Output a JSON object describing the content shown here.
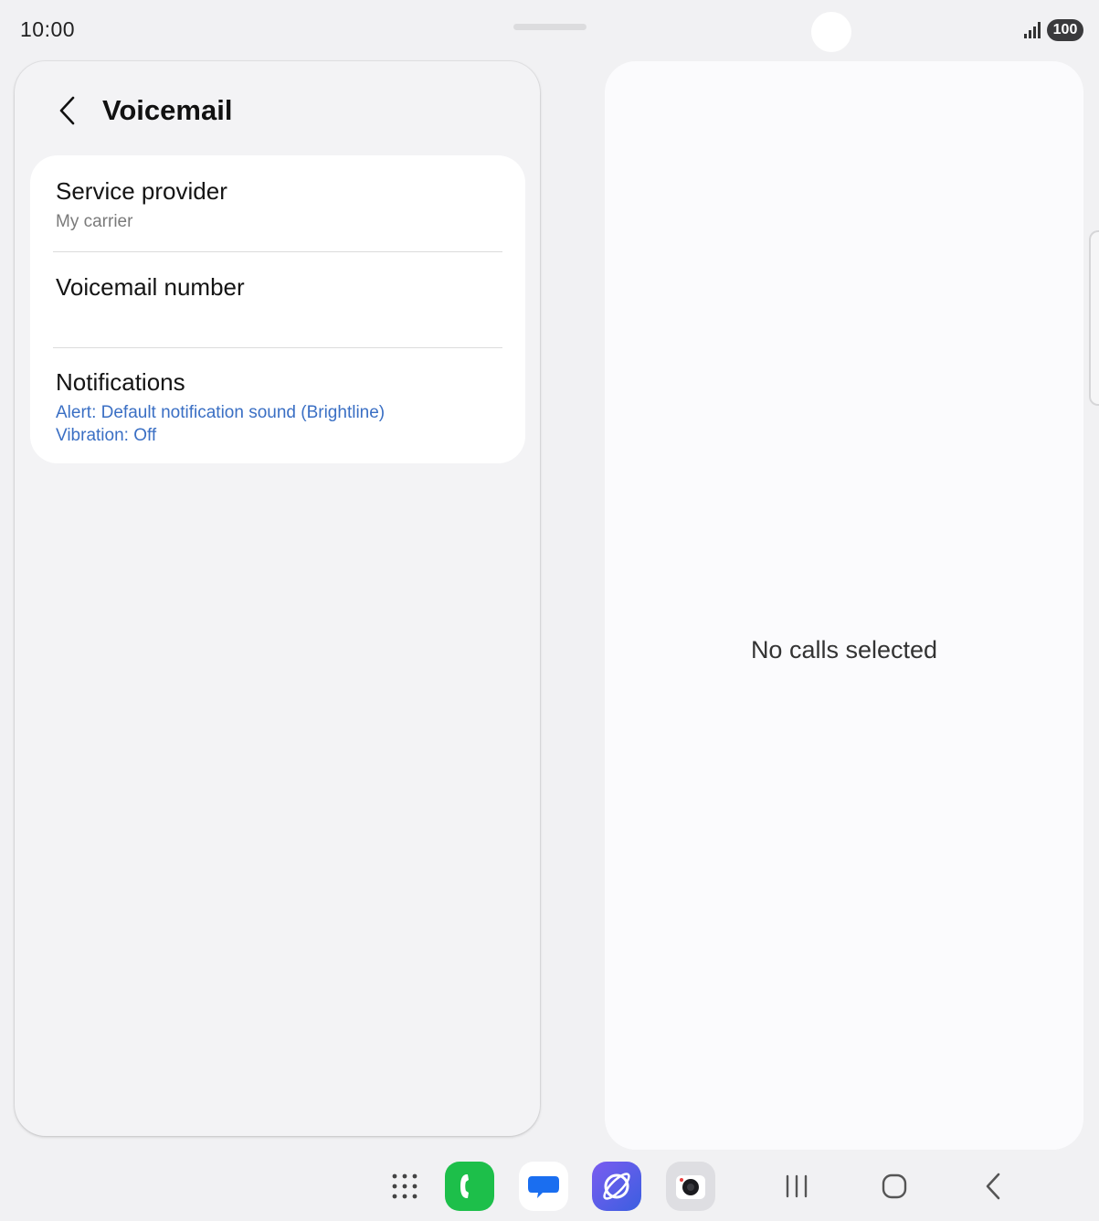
{
  "status_bar": {
    "time": "10:00",
    "battery": "100",
    "icons": [
      "signal-icon",
      "battery-icon"
    ]
  },
  "header": {
    "title": "Voicemail",
    "back_icon": "chevron-left-icon"
  },
  "settings": {
    "service_provider": {
      "title": "Service provider",
      "value": "My carrier"
    },
    "voicemail_number": {
      "title": "Voicemail number"
    },
    "notifications": {
      "title": "Notifications",
      "alert": "Alert: Default notification sound (Brightline)",
      "vibration": "Vibration: Off"
    }
  },
  "detail_pane": {
    "empty_message": "No calls selected"
  },
  "taskbar": {
    "apps": [
      {
        "name": "apps-grid-icon"
      },
      {
        "name": "phone-app-icon",
        "color": "#1dbf4a"
      },
      {
        "name": "messages-app-icon",
        "color": "#1a6ef0"
      },
      {
        "name": "internet-app-icon",
        "color": "#5b4ee8"
      },
      {
        "name": "camera-app-icon",
        "color": "#d8d8dc"
      }
    ],
    "nav": [
      "recents-icon",
      "home-icon",
      "back-icon"
    ]
  },
  "colors": {
    "accent_blue": "#3a6fc4",
    "background": "#f1f1f3",
    "card": "#ffffff"
  }
}
